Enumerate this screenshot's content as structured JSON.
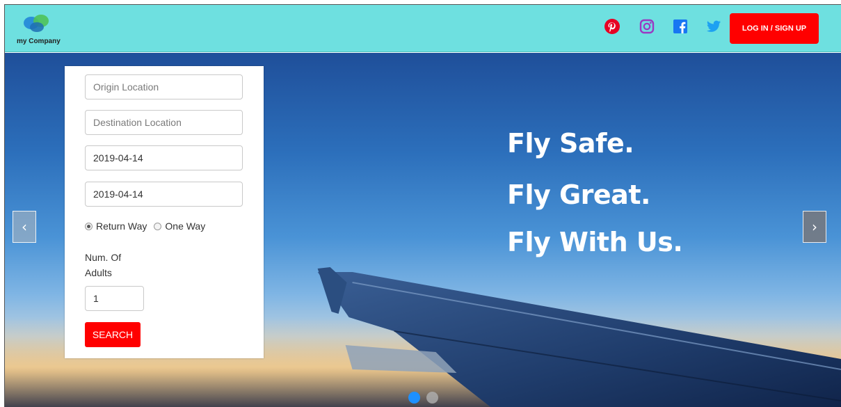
{
  "header": {
    "logo_text": "my Company",
    "social": [
      {
        "icon": "pinterest-icon",
        "color": "#e60023"
      },
      {
        "icon": "instagram-icon",
        "color": "#8a3ab9"
      },
      {
        "icon": "facebook-icon",
        "color": "#1877f2"
      },
      {
        "icon": "twitter-icon",
        "color": "#1da1f2"
      }
    ],
    "login_label": "LOG IN / SIGN UP"
  },
  "search": {
    "origin_placeholder": "Origin Location",
    "destination_placeholder": "Destination Location",
    "depart_date": "2019-04-14",
    "return_date": "2019-04-14",
    "trip_types": [
      "Return Way",
      "One Way"
    ],
    "selected_trip_type": "Return Way",
    "adults_label": "Num. Of Adults",
    "adults_value": "1",
    "search_label": "SEARCH"
  },
  "hero": {
    "tagline": [
      "Fly Safe.",
      "Fly Great.",
      "Fly With Us."
    ],
    "prev_glyph": "‹",
    "next_glyph": "›",
    "slides_total": 2,
    "active_slide": 1
  },
  "colors": {
    "header_bg": "#6ee0e0",
    "accent_red": "#ff0000",
    "active_dot": "#1e90ff",
    "inactive_dot": "#b0b0b0"
  }
}
